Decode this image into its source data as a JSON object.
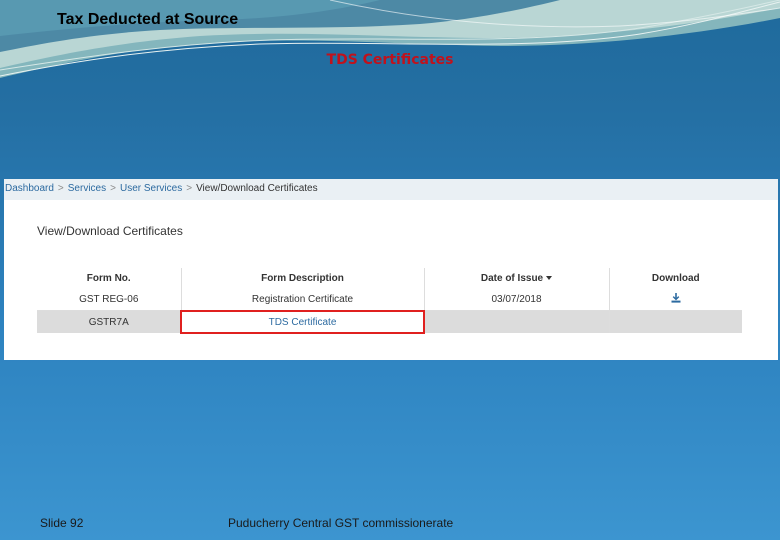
{
  "slide": {
    "title": "Tax Deducted at Source",
    "subtitle": "TDS Certificates",
    "footer_slide": "Slide 92",
    "footer_org": "Puducherry Central GST commissionerate"
  },
  "breadcrumb": {
    "items": [
      "Dashboard",
      "Services",
      "User Services"
    ],
    "current": "View/Download Certificates",
    "separator": ">"
  },
  "page": {
    "heading": "View/Download Certificates"
  },
  "table": {
    "headers": [
      "Form No.",
      "Form Description",
      "Date of Issue",
      "Download"
    ],
    "rows": [
      [
        "GST REG-06",
        "Registration Certificate",
        "03/07/2018",
        ""
      ],
      [
        "GSTR7A",
        "TDS Certificate",
        "",
        ""
      ]
    ]
  },
  "colors": {
    "accent_red": "#e0201f",
    "link_blue": "#2c6aa0",
    "subtitle_red": "#c0121c"
  }
}
